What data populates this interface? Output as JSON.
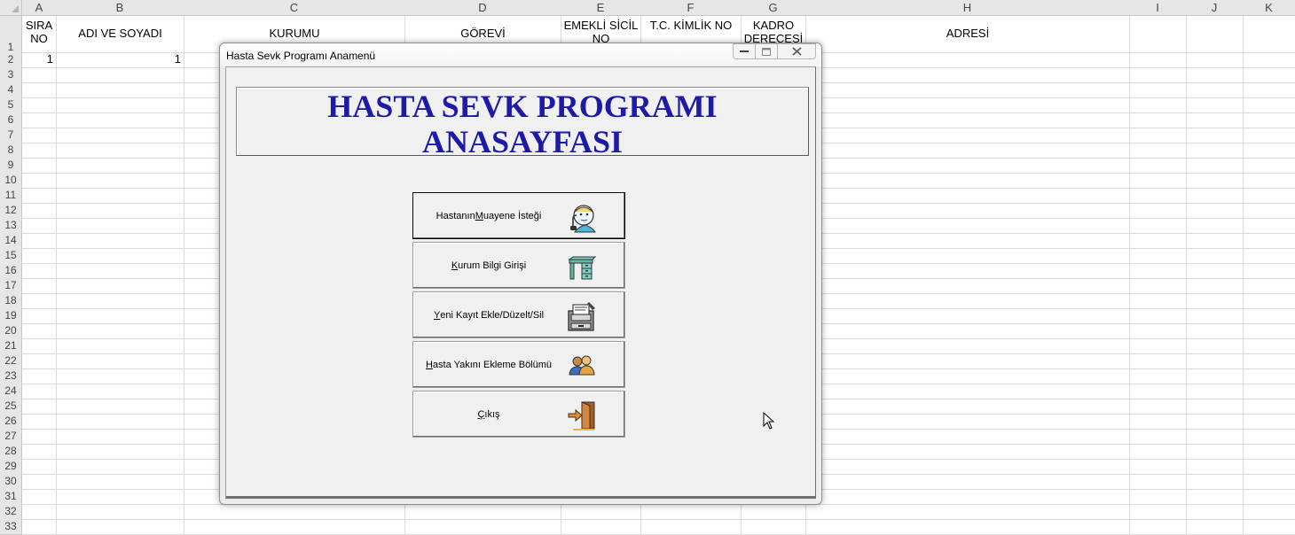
{
  "spreadsheet": {
    "columns": [
      "A",
      "B",
      "C",
      "D",
      "E",
      "F",
      "G",
      "H",
      "I",
      "J",
      "K"
    ],
    "rows": [
      "1",
      "2",
      "3",
      "4",
      "5",
      "6",
      "7",
      "8",
      "9",
      "10",
      "11",
      "12",
      "13",
      "14",
      "15",
      "16",
      "17",
      "18",
      "19",
      "20",
      "21",
      "22",
      "23",
      "24",
      "25",
      "26",
      "27",
      "28",
      "29",
      "30",
      "31",
      "32",
      "33"
    ],
    "header_cells": {
      "A": "SIRA NO",
      "B": "ADI VE SOYADI",
      "C": "KURUMU",
      "D": "GÖREVİ",
      "E": "EMEKLİ SİCİL NO",
      "F": "T.C. KİMLİK NO",
      "G": "KADRO DERECESİ",
      "H": "ADRESİ"
    },
    "row2": {
      "A": "1",
      "B": "1"
    }
  },
  "dialog": {
    "title": "Hasta Sevk Programı Anamenü",
    "banner_title": "HASTA SEVK PROGRAMI ANASAYFASI",
    "banner_color": "#1d1aa8",
    "buttons": [
      {
        "label": "Hastanın Muayene İsteği",
        "accel": "M",
        "icon": "doctor-phone-icon"
      },
      {
        "label": "Kurum Bilgi Girişi",
        "accel": "K",
        "icon": "desk-icon"
      },
      {
        "label": "Yeni Kayıt Ekle/Düzelt/Sil",
        "accel": "Y",
        "icon": "file-drawer-icon"
      },
      {
        "label": "Hasta Yakını Ekleme Bölümü",
        "accel": "H",
        "icon": "people-icon"
      },
      {
        "label": "Çıkış",
        "accel": "Ç",
        "icon": "exit-door-icon"
      }
    ]
  }
}
